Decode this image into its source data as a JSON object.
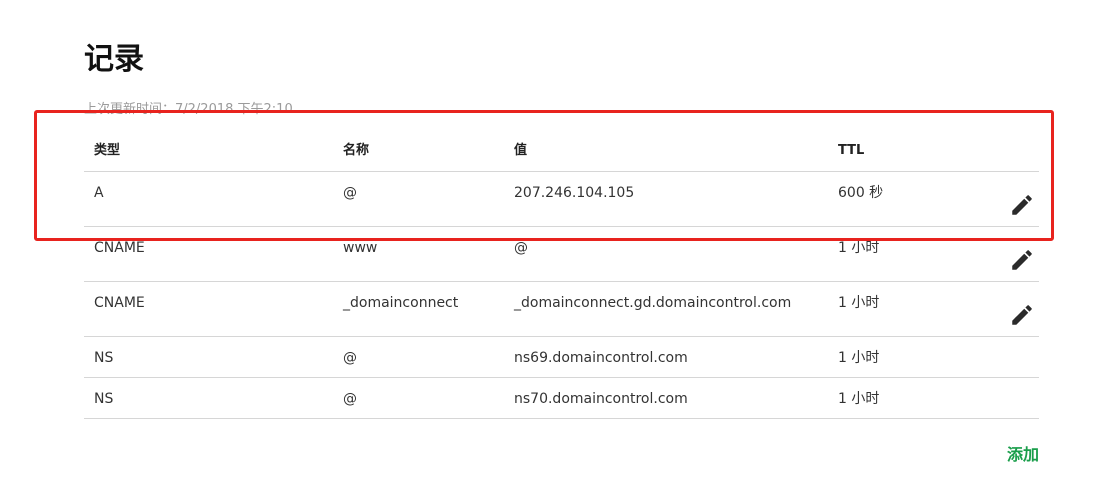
{
  "page": {
    "title": "记录",
    "last_updated": "上次更新时间：7/2/2018 下午2:10"
  },
  "table": {
    "headers": {
      "type": "类型",
      "name": "名称",
      "value": "值",
      "ttl": "TTL"
    },
    "rows": [
      {
        "type": "A",
        "name": "@",
        "value": "207.246.104.105",
        "ttl": "600 秒",
        "editable": true
      },
      {
        "type": "CNAME",
        "name": "www",
        "value": "@",
        "ttl": "1 小时",
        "editable": true
      },
      {
        "type": "CNAME",
        "name": "_domainconnect",
        "value": "_domainconnect.gd.domaincontrol.com",
        "ttl": "1 小时",
        "editable": true
      },
      {
        "type": "NS",
        "name": "@",
        "value": "ns69.domaincontrol.com",
        "ttl": "1 小时",
        "editable": false
      },
      {
        "type": "NS",
        "name": "@",
        "value": "ns70.domaincontrol.com",
        "ttl": "1 小时",
        "editable": false
      }
    ]
  },
  "actions": {
    "add_label": "添加"
  },
  "icons": {
    "edit": "pencil-icon"
  },
  "colors": {
    "accent_green": "#1a9e4b",
    "highlight_red": "#e8231e",
    "divider": "#d6d6d6"
  }
}
